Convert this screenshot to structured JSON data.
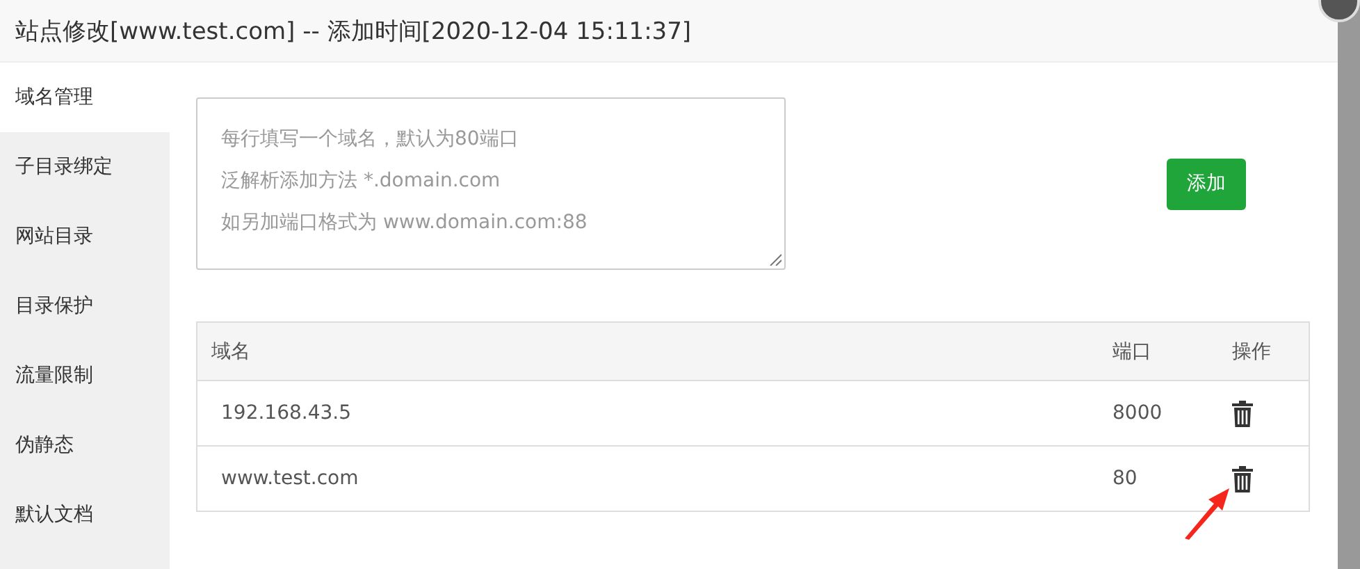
{
  "window": {
    "title": "站点修改[www.test.com] -- 添加时间[2020-12-04 15:11:37]"
  },
  "sidebar": {
    "items": [
      {
        "label": "域名管理",
        "selected": true
      },
      {
        "label": "子目录绑定",
        "selected": false
      },
      {
        "label": "网站目录",
        "selected": false
      },
      {
        "label": "目录保护",
        "selected": false
      },
      {
        "label": "流量限制",
        "selected": false
      },
      {
        "label": "伪静态",
        "selected": false
      },
      {
        "label": "默认文档",
        "selected": false
      }
    ]
  },
  "domain_input": {
    "placeholder_lines": [
      "每行填写一个域名，默认为80端口",
      "泛解析添加方法 *.domain.com",
      "如另加端口格式为 www.domain.com:88"
    ]
  },
  "add_button": "添加",
  "table": {
    "columns": [
      "域名",
      "端口",
      "操作"
    ],
    "rows": [
      {
        "domain": "192.168.43.5",
        "port": "8000"
      },
      {
        "domain": "www.test.com",
        "port": "80"
      }
    ]
  }
}
